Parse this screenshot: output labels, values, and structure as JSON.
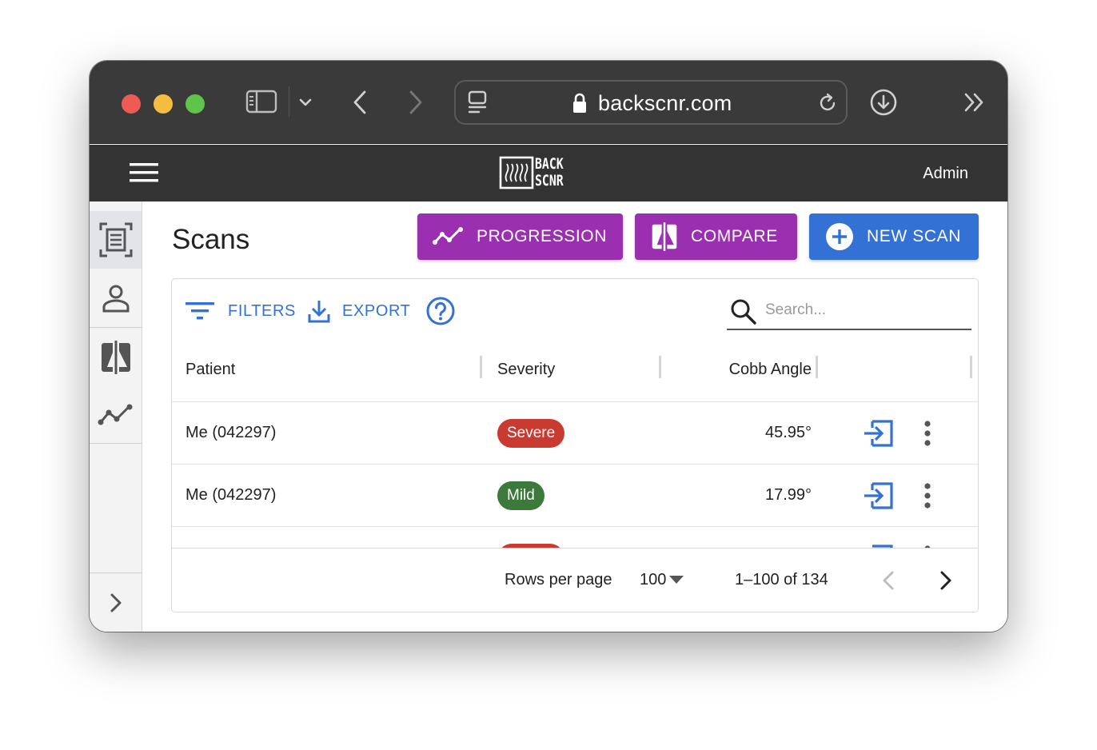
{
  "browser": {
    "url": "backscnr.com"
  },
  "header": {
    "logo_top": "BACK",
    "logo_bottom": "SCNR",
    "user_label": "Admin"
  },
  "page": {
    "title": "Scans",
    "buttons": {
      "progression": "PROGRESSION",
      "compare": "COMPARE",
      "new_scan": "NEW SCAN"
    }
  },
  "toolbar": {
    "filters_label": "FILTERS",
    "export_label": "EXPORT",
    "search_placeholder": "Search..."
  },
  "table": {
    "columns": {
      "patient": "Patient",
      "severity": "Severity",
      "cobb_angle": "Cobb Angle"
    },
    "rows": [
      {
        "patient": "Me (042297)",
        "severity": "Severe",
        "cobb_angle": "45.95°"
      },
      {
        "patient": "Me (042297)",
        "severity": "Mild",
        "cobb_angle": "17.99°"
      }
    ]
  },
  "pagination": {
    "rows_per_page_label": "Rows per page",
    "rows_per_page_value": "100",
    "range_text": "1–100 of 134"
  },
  "colors": {
    "purple": "#9a2faf",
    "blue": "#3471d4",
    "severe": "#c93a31",
    "mild": "#3b7a3a",
    "appbar": "#333333"
  }
}
